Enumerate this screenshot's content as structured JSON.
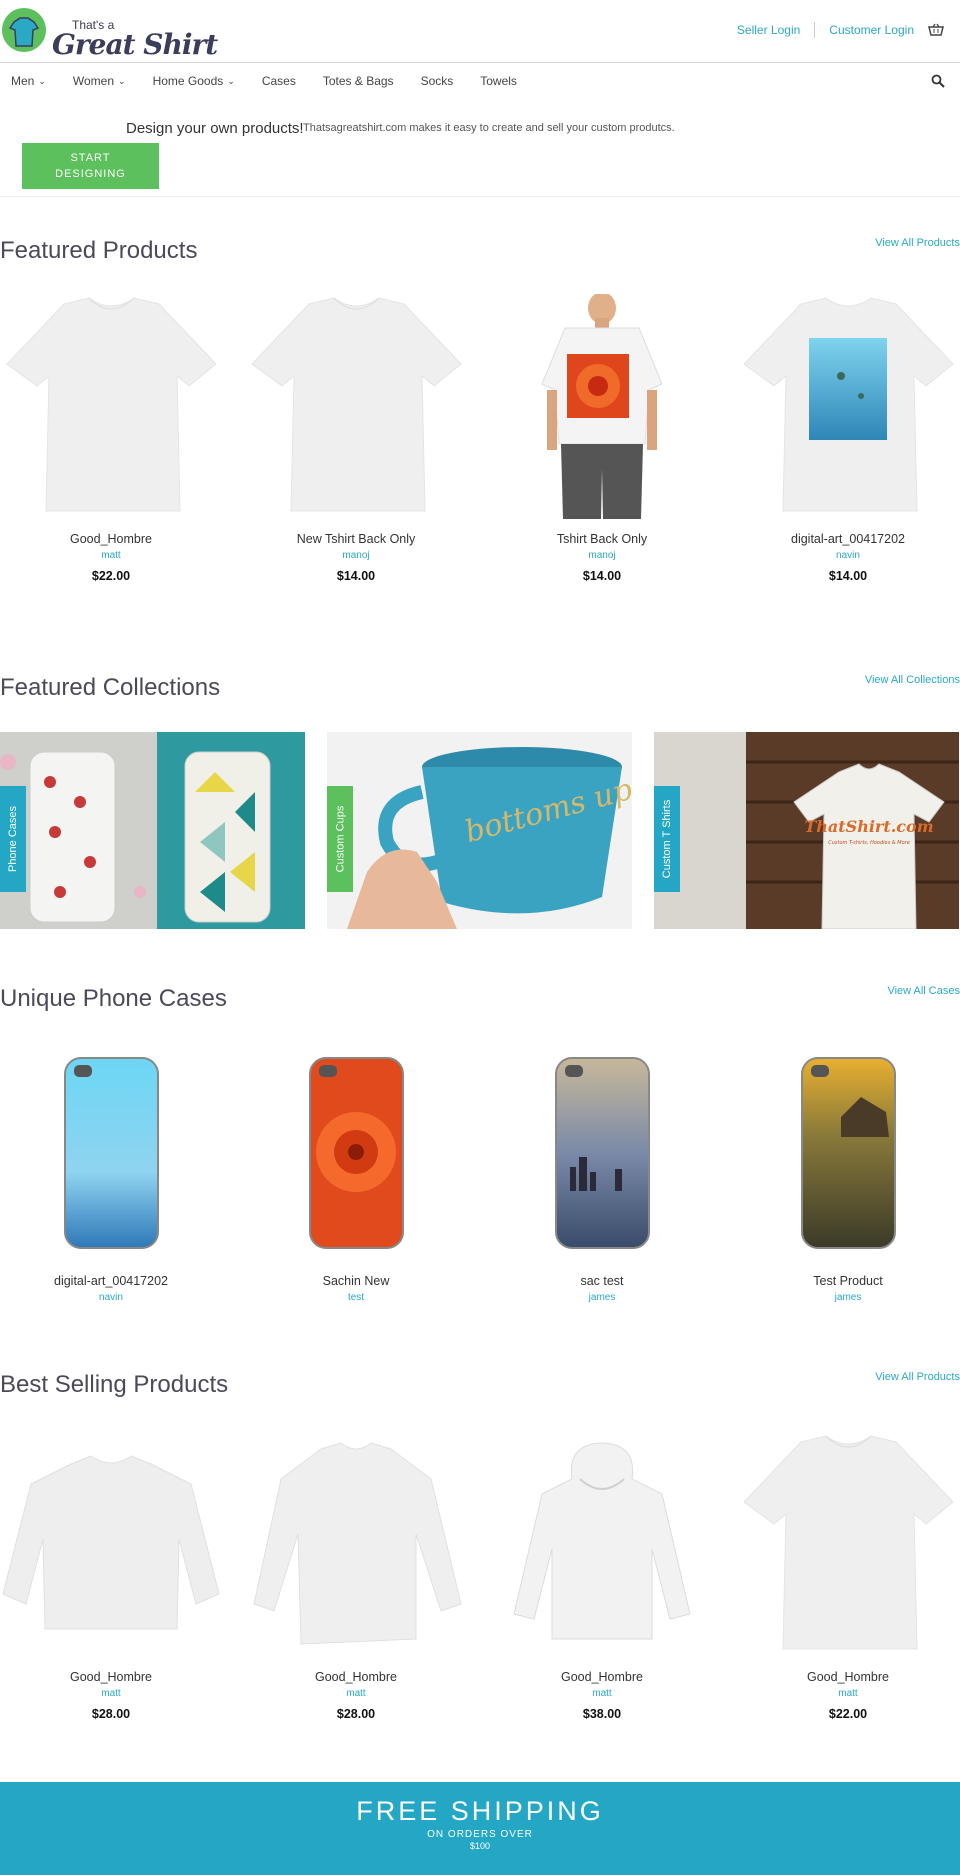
{
  "header": {
    "logo_small": "That's a",
    "logo_big": "Great Shirt",
    "seller_login": "Seller Login",
    "customer_login": "Customer Login"
  },
  "nav": {
    "items": [
      {
        "label": "Men",
        "dropdown": true
      },
      {
        "label": "Women",
        "dropdown": true
      },
      {
        "label": "Home Goods",
        "dropdown": true
      },
      {
        "label": "Cases",
        "dropdown": false
      },
      {
        "label": "Totes & Bags",
        "dropdown": false
      },
      {
        "label": "Socks",
        "dropdown": false
      },
      {
        "label": "Towels",
        "dropdown": false
      }
    ]
  },
  "promo": {
    "title": "Design your own products!",
    "text": "Thatsagreatshirt.com makes it easy to create and sell your custom produtcs.",
    "button_line1": "START",
    "button_line2": "DESIGNING"
  },
  "featured": {
    "title": "Featured Products",
    "link": "View All Products",
    "items": [
      {
        "name": "Good_Hombre",
        "vendor": "matt",
        "price": "$22.00"
      },
      {
        "name": "New Tshirt Back Only",
        "vendor": "manoj",
        "price": "$14.00"
      },
      {
        "name": "Tshirt Back Only",
        "vendor": "manoj",
        "price": "$14.00"
      },
      {
        "name": "digital-art_00417202",
        "vendor": "navin",
        "price": "$14.00"
      }
    ]
  },
  "collections": {
    "title": "Featured Collections",
    "link": "View All Collections",
    "items": [
      {
        "label": "Phone Cases",
        "tag_color": "#23a7c5"
      },
      {
        "label": "Custom Cups",
        "tag_color": "#5cc05c"
      },
      {
        "label": "Custom T Shirts",
        "tag_color": "#23a7c5",
        "shirt_text": "ThatShirt.com",
        "shirt_sub": "Custom T-shirts, Hoodies & More"
      }
    ],
    "cup_text": "bottoms up"
  },
  "cases": {
    "title": "Unique Phone Cases",
    "link": "View All Cases",
    "items": [
      {
        "name": "digital-art_00417202",
        "vendor": "navin"
      },
      {
        "name": "Sachin New",
        "vendor": "test"
      },
      {
        "name": "sac test",
        "vendor": "james"
      },
      {
        "name": "Test Product",
        "vendor": "james"
      }
    ]
  },
  "best": {
    "title": "Best Selling Products",
    "link": "View All Products",
    "items": [
      {
        "name": "Good_Hombre",
        "vendor": "matt",
        "price": "$28.00"
      },
      {
        "name": "Good_Hombre",
        "vendor": "matt",
        "price": "$28.00"
      },
      {
        "name": "Good_Hombre",
        "vendor": "matt",
        "price": "$38.00"
      },
      {
        "name": "Good_Hombre",
        "vendor": "matt",
        "price": "$22.00"
      }
    ]
  },
  "shipping": {
    "title": "FREE SHIPPING",
    "subtitle": "ON ORDERS OVER",
    "amount": "$100"
  },
  "colors": {
    "accent_blue": "#23a7c5",
    "accent_green": "#5cc05c",
    "link_blue": "#2aa8c4"
  }
}
